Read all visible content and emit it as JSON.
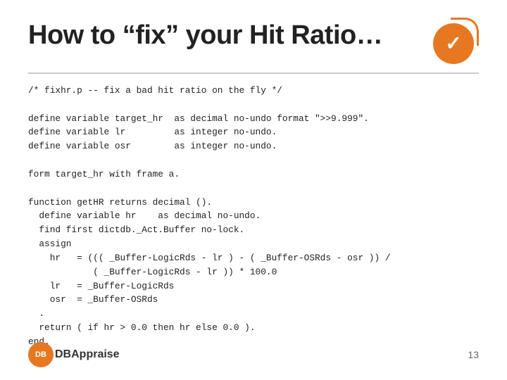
{
  "slide": {
    "title": "How to “fix” your Hit Ratio…",
    "divider": true,
    "code": "/* fixhr.p -- fix a bad hit ratio on the fly */\n\ndefine variable target_hr  as decimal no-undo format \">>9.999\".\ndefine variable lr         as integer no-undo.\ndefine variable osr        as integer no-undo.\n\nform target_hr with frame a.\n\nfunction getHR returns decimal ().\n  define variable hr    as decimal no-undo.\n  find first dictdb._Act.Buffer no-lock.\n  assign\n    hr   = ((( _Buffer-LogicRds - lr ) - ( _Buffer-OSRds - osr )) /\n            ( _Buffer-LogicRds - lr )) * 100.0\n    lr   = _Buffer-LogicRds\n    osr  = _Buffer-OSRds\n  .\n  return ( if hr > 0.0 then hr else 0.0 ).\nend.",
    "footer": {
      "logo_circle": "DB",
      "logo_name": "DBAppraise",
      "page_number": "13"
    }
  }
}
